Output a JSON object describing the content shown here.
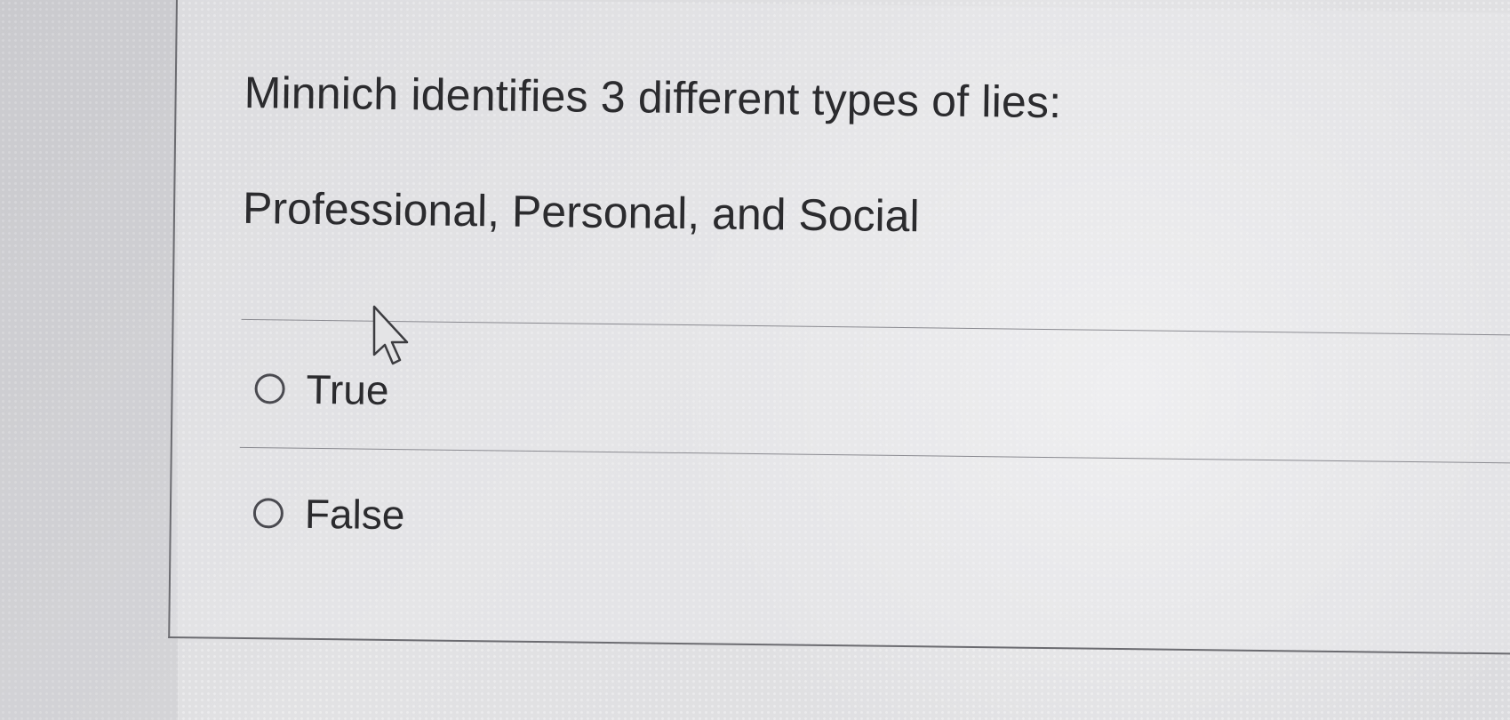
{
  "question": {
    "prompt": "Minnich identifies 3 different types of lies:",
    "statement": "Professional, Personal, and Social"
  },
  "options": [
    {
      "label": "True",
      "selected": false
    },
    {
      "label": "False",
      "selected": false
    }
  ],
  "colors": {
    "text": "#2b2b2e",
    "border": "#6b6b70",
    "background": "#d9d9db"
  },
  "icons": {
    "pointer": "mouse-pointer-icon"
  }
}
